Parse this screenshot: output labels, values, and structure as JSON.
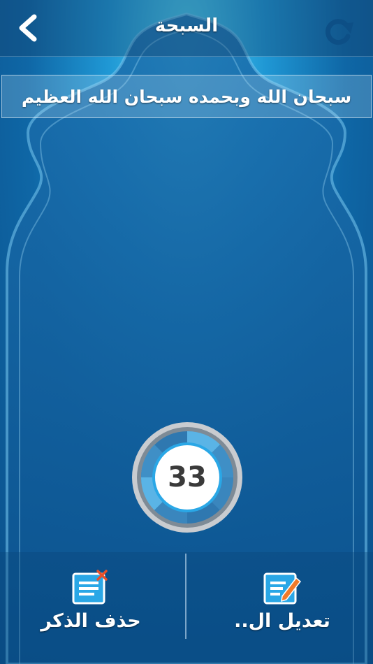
{
  "header": {
    "title": "السبحة"
  },
  "dhikr": {
    "text": "سبحان الله وبحمده سبحان الله العظيم"
  },
  "counter": {
    "value": "33"
  },
  "actions": {
    "delete_label": "حذف الذكر",
    "edit_label": "تعديل ال.."
  },
  "colors": {
    "accent": "#2aa7e6",
    "delete_badge": "#e8502a",
    "edit_pencil": "#f07a2a"
  },
  "icons": {
    "back": "chevron-left-icon",
    "refresh": "refresh-icon",
    "delete": "delete-list-icon",
    "edit": "edit-list-icon"
  }
}
